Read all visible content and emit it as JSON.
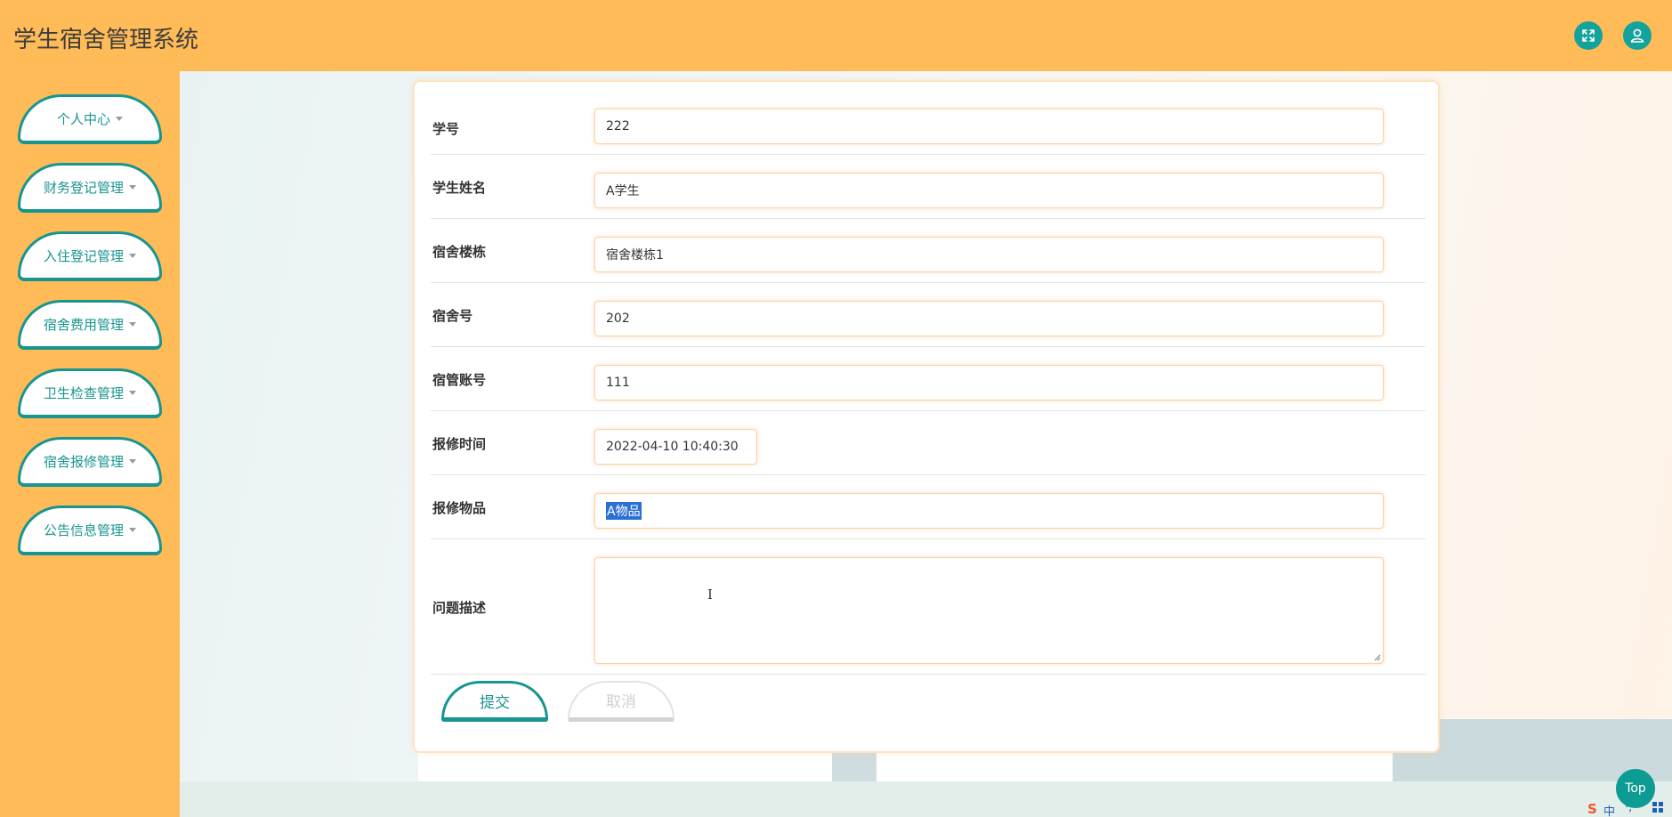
{
  "header": {
    "title": "学生宿舍管理系统",
    "fullscreen_icon": "fullscreen-icon",
    "user_icon": "user-icon",
    "accent_color": "#ffbb57",
    "button_color": "#14a39c"
  },
  "sidebar": {
    "items": [
      {
        "label": "个人中心"
      },
      {
        "label": "财务登记管理"
      },
      {
        "label": "入住登记管理"
      },
      {
        "label": "宿舍费用管理"
      },
      {
        "label": "卫生检查管理"
      },
      {
        "label": "宿舍报修管理"
      },
      {
        "label": "公告信息管理"
      }
    ]
  },
  "form": {
    "fields": [
      {
        "label": "学号",
        "value": "222"
      },
      {
        "label": "学生姓名",
        "value": "A学生"
      },
      {
        "label": "宿舍楼栋",
        "value": "宿舍楼栋1"
      },
      {
        "label": "宿舍号",
        "value": "202"
      },
      {
        "label": "宿管账号",
        "value": "111"
      },
      {
        "label": "报修时间",
        "value": "2022-04-10 10:40:30"
      },
      {
        "label": "报修物品",
        "value": "A物品"
      },
      {
        "label": "问题描述",
        "value": ""
      }
    ],
    "submit_label": "提交",
    "cancel_label": "取消"
  },
  "top_button": {
    "label": "Top"
  },
  "ime": {
    "logo": "S",
    "mode": "中",
    "dots": "·,",
    "grid_icon": "keyboard-icon"
  }
}
